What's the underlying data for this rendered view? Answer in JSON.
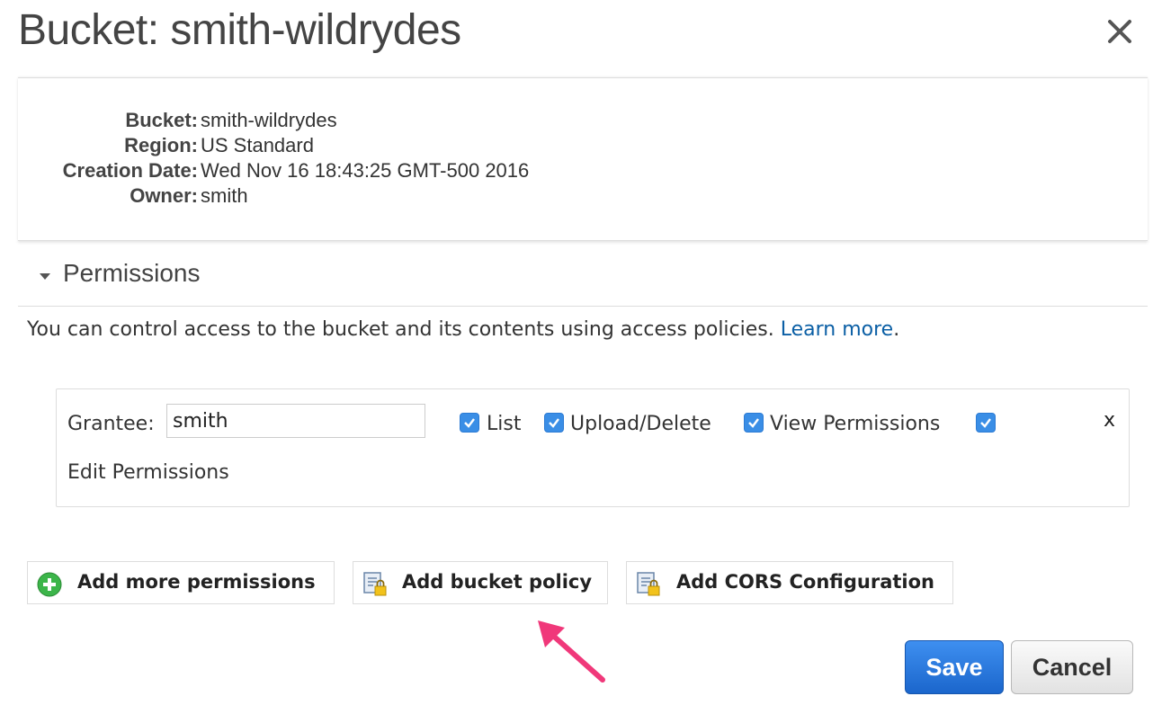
{
  "dialog": {
    "title": "Bucket: smith-wildrydes",
    "close_icon": "close-icon"
  },
  "properties": [
    {
      "label": "Bucket:",
      "value": "smith-wildrydes"
    },
    {
      "label": "Region:",
      "value": "US Standard"
    },
    {
      "label": "Creation Date:",
      "value": "Wed Nov 16 18:43:25 GMT-500 2016"
    },
    {
      "label": "Owner:",
      "value": "smith"
    }
  ],
  "permissions": {
    "section_title": "Permissions",
    "description": "You can control access to the bucket and its contents using access policies.",
    "learn_more": "Learn more",
    "period": ".",
    "grantee": {
      "label": "Grantee:",
      "value": "smith",
      "checkboxes": [
        {
          "label": "List",
          "checked": true
        },
        {
          "label": "Upload/Delete",
          "checked": true
        },
        {
          "label": "View Permissions",
          "checked": true
        },
        {
          "label": "Edit Permissions",
          "checked": true
        }
      ],
      "remove": "x"
    }
  },
  "actions": {
    "add_permissions": "Add more permissions",
    "add_bucket_policy": "Add bucket policy",
    "add_cors": "Add CORS Configuration"
  },
  "footer": {
    "save": "Save",
    "cancel": "Cancel"
  },
  "colors": {
    "accent": "#3a8ee6",
    "link": "#0b5fa5",
    "annotation_arrow": "#f0387a",
    "add_icon": "#3cb54a"
  }
}
